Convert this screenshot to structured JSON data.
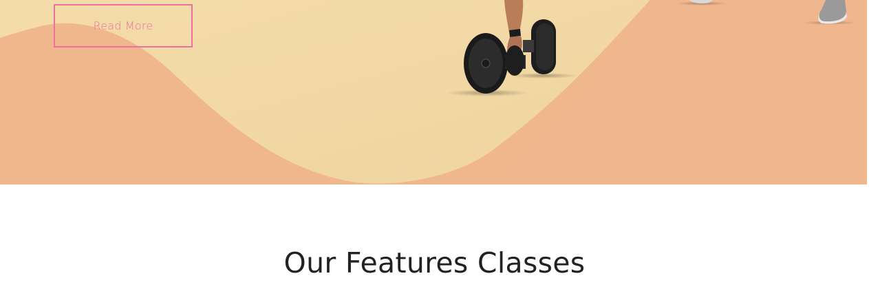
{
  "hero": {
    "cta_label": "Read More",
    "colors": {
      "cream": "#f1d9a5",
      "peach": "#f0b68c",
      "accent_pink": "#ee6fa3"
    },
    "image": "athlete-holding-dumbbells"
  },
  "features": {
    "title": "Our Features Classes"
  }
}
